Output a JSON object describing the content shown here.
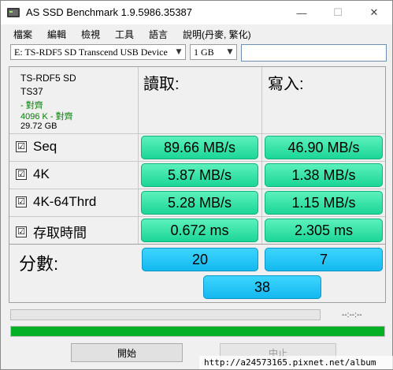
{
  "window": {
    "title": "AS SSD Benchmark 1.9.5986.35387",
    "minimize_glyph": "—",
    "maximize_glyph": "☐",
    "close_glyph": "✕"
  },
  "menu": [
    "檔案",
    "編輯",
    "檢視",
    "工具",
    "語言",
    "說明(丹麥, 繁化)"
  ],
  "toolbar": {
    "device_select": "E: TS-RDF5 SD  Transcend USB Device",
    "size_select": "1 GB",
    "arrow_glyph": "▼",
    "text_value": ""
  },
  "device_info": {
    "name": "TS-RDF5 SD",
    "firmware": "TS37",
    "alignment1": " - 對齊",
    "alignment2": "4096 K - 對齊",
    "capacity": "29.72 GB"
  },
  "columns": {
    "read": "讀取:",
    "write": "寫入:"
  },
  "rows": [
    {
      "check": "☑",
      "label": "Seq",
      "read": "89.66 MB/s",
      "write": "46.90 MB/s"
    },
    {
      "check": "☑",
      "label": "4K",
      "read": "5.87 MB/s",
      "write": "1.38 MB/s"
    },
    {
      "check": "☑",
      "label": "4K-64Thrd",
      "read": "5.28 MB/s",
      "write": "1.15 MB/s"
    },
    {
      "check": "☑",
      "label": "存取時間",
      "read": "0.672 ms",
      "write": "2.305 ms"
    }
  ],
  "score": {
    "label": "分數:",
    "read": "20",
    "write": "7",
    "total": "38"
  },
  "progress": {
    "time": "--:--:--",
    "task_fraction": 0,
    "overall_fraction": 1.0
  },
  "buttons": {
    "start": "開始",
    "stop": "中止"
  },
  "watermark": "http://a24573165.pixnet.net/album",
  "colors": {
    "green_result": "#19d595",
    "blue_score": "#12b8ef",
    "progress_fill": "#06b025",
    "alignment_text": "#008000"
  },
  "icons": {
    "app": "as-ssd-app-icon",
    "checkbox": "checked-checkbox-icon"
  }
}
